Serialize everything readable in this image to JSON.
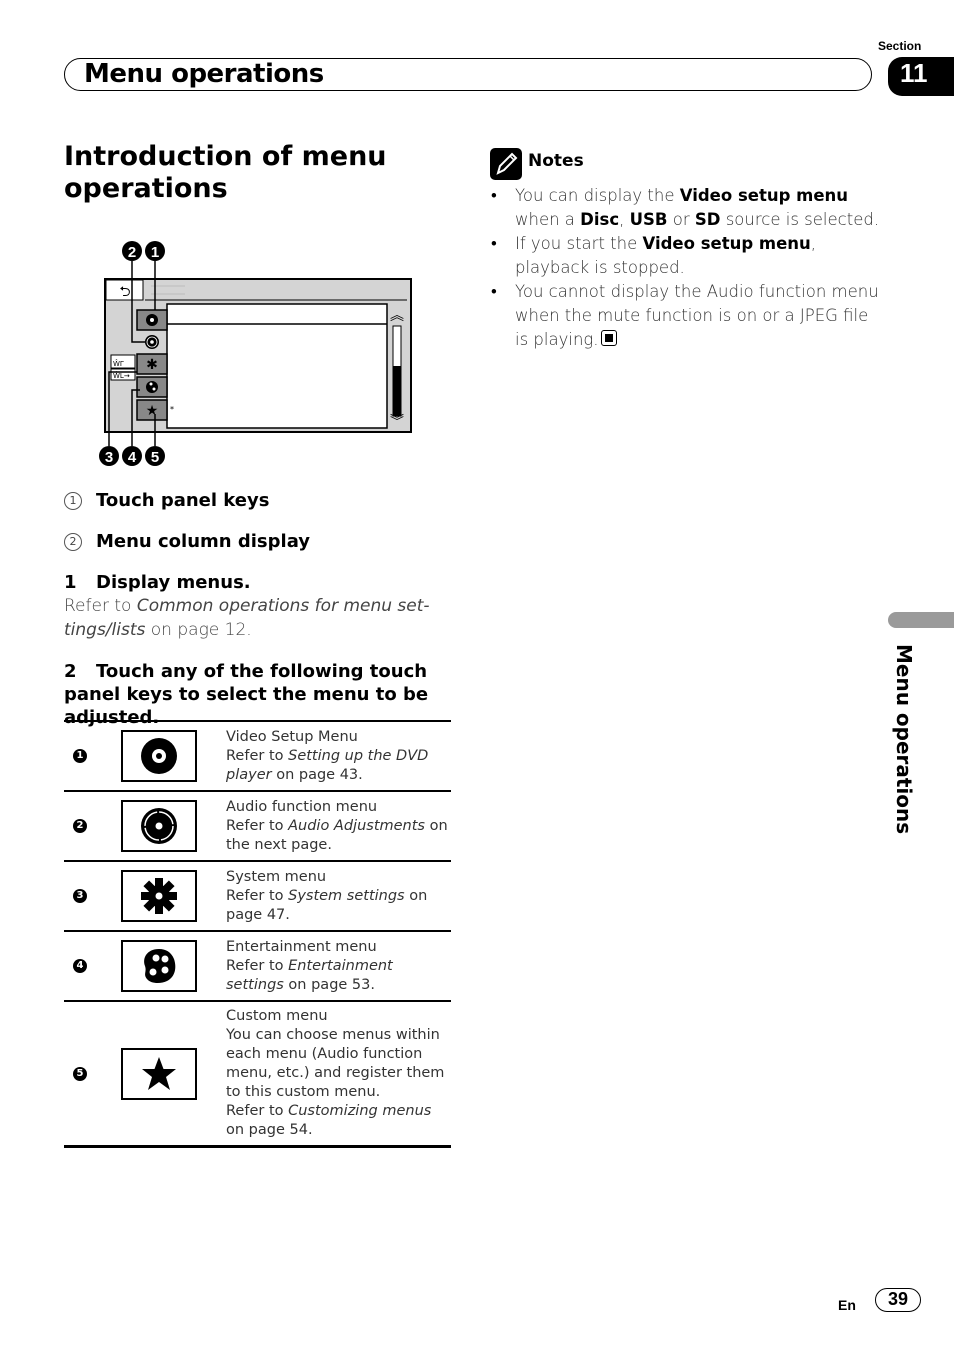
{
  "header": {
    "section_label": "Section",
    "section_number": "11",
    "title": "Menu operations"
  },
  "intro": {
    "title": "Introduction of menu operations"
  },
  "diagram": {
    "callouts": [
      "1",
      "2",
      "3",
      "4",
      "5"
    ],
    "back_icon": "back-arrow-icon",
    "asterisk": "*"
  },
  "legend": [
    {
      "marker": "1",
      "label": "Touch panel keys"
    },
    {
      "marker": "2",
      "label": "Menu column display"
    }
  ],
  "steps": [
    {
      "number": "1",
      "title": "Display menus.",
      "body_prefix": "Refer to ",
      "body_link": "Common operations for menu set-tings/lists",
      "body_suffix": " on page 12."
    },
    {
      "number": "2",
      "title": "Touch any of the following touch panel keys to select the menu to be adjusted."
    }
  ],
  "menu_table": [
    {
      "num": "1",
      "icon": "disc-icon",
      "name": "Video Setup Menu",
      "prefix": "Refer to ",
      "link": "Setting up the DVD player",
      "suffix": " on page 43."
    },
    {
      "num": "2",
      "icon": "audio-disc-icon",
      "name": "Audio function menu",
      "prefix": "Refer to ",
      "link": "Audio Adjustments",
      "suffix": " on the next page."
    },
    {
      "num": "3",
      "icon": "gear-icon",
      "name": "System menu",
      "prefix": "Refer to ",
      "link": "System settings",
      "suffix": " on page 47."
    },
    {
      "num": "4",
      "icon": "palette-icon",
      "name": "Entertainment menu",
      "prefix": "Refer to ",
      "link": "Entertainment settings",
      "suffix": " on page 53."
    },
    {
      "num": "5",
      "icon": "star-icon",
      "name": "Custom menu",
      "desc": "You can choose menus within each menu (Audio function menu, etc.) and register them to this custom menu.",
      "prefix": "Refer to ",
      "link": "Customizing menus",
      "suffix": " on page 54."
    }
  ],
  "notes": {
    "title": "Notes",
    "items": [
      {
        "parts": [
          [
            "You can display the ",
            false
          ],
          [
            "Video setup menu",
            true
          ],
          [
            " when a ",
            false
          ],
          [
            "Disc",
            true
          ],
          [
            ", ",
            false
          ],
          [
            "USB",
            true
          ],
          [
            " or ",
            false
          ],
          [
            "SD",
            true
          ],
          [
            " source is selected.",
            false
          ]
        ]
      },
      {
        "parts": [
          [
            "If you start the ",
            false
          ],
          [
            "Video setup menu",
            true
          ],
          [
            ", playback is stopped.",
            false
          ]
        ]
      },
      {
        "parts": [
          [
            "You cannot display the Audio function menu when the mute function is on or a JPEG file is playing.",
            false
          ]
        ],
        "end_mark": true
      }
    ]
  },
  "side_tab": {
    "label": "Menu operations"
  },
  "footer": {
    "language": "En",
    "page_number": "39"
  }
}
